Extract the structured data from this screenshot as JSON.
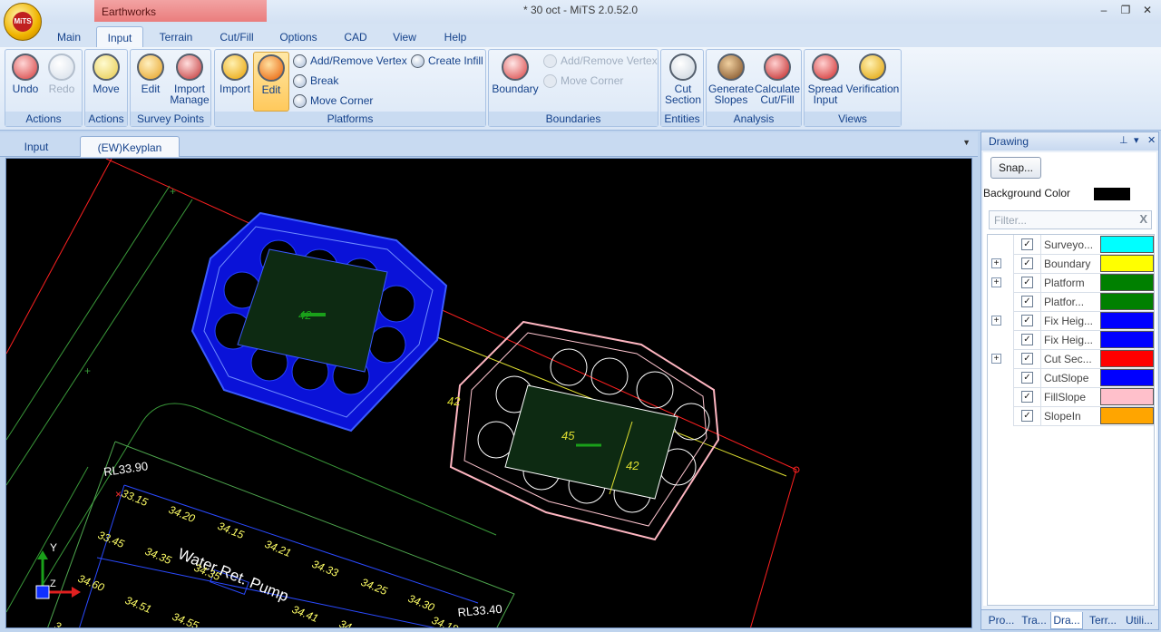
{
  "titlebar": {
    "context_tab": "Earthworks",
    "app_title": "* 30 oct - MiTS 2.0.52.0",
    "logo_text": "MiTS",
    "minimize": "–",
    "maximize": "❐",
    "close": "✕"
  },
  "menu": [
    "Main",
    "Input",
    "Terrain",
    "Cut/Fill",
    "Options",
    "CAD",
    "View",
    "Help"
  ],
  "ribbon": {
    "actions": {
      "label": "Actions",
      "undo": "Undo",
      "redo": "Redo"
    },
    "actions2": {
      "label": "Actions",
      "move": "Move"
    },
    "survey": {
      "label": "Survey Points",
      "edit": "Edit",
      "import1": "Import",
      "import2": "Manage"
    },
    "platforms": {
      "label": "Platforms",
      "import": "Import",
      "edit": "Edit",
      "add_remove_vertex": "Add/Remove Vertex",
      "create_infill": "Create Infill",
      "break": "Break",
      "move_corner": "Move Corner"
    },
    "boundaries": {
      "label": "Boundaries",
      "boundary": "Boundary",
      "add_remove_vertex": "Add/Remove Vertex",
      "move_corner": "Move Corner"
    },
    "entities": {
      "label": "Entities",
      "cut1": "Cut",
      "cut2": "Section"
    },
    "analysis": {
      "label": "Analysis",
      "gen1": "Generate",
      "gen2": "Slopes",
      "calc1": "Calculate",
      "calc2": "Cut/Fill"
    },
    "views": {
      "label": "Views",
      "spread1": "Spread",
      "spread2": "Input",
      "verification": "Verification"
    }
  },
  "doc_tabs": [
    "Input",
    "(EW)Keyplan"
  ],
  "drawing": {
    "labels": {
      "platform1": "42",
      "platform2_a": "45",
      "platform2_b": "42",
      "slope_label": "42",
      "rl1": "RL33.90",
      "rl2": "RL33.40",
      "pump": "Water Ret. Pump",
      "axis_y": "Y",
      "axis_z": "Z"
    },
    "levels": [
      "33.15",
      "34.20",
      "34.15",
      "34.21",
      "34.33",
      "34.25",
      "34.30",
      "33.45",
      "34.35",
      "34.35",
      "34.60",
      "34.51",
      "34.55",
      "34.41",
      "34.18"
    ],
    "levels_row_partial": [
      "34.",
      "3"
    ]
  },
  "panel": {
    "title": "Drawing",
    "pin": "⊥",
    "menu": "▾",
    "close": "✕",
    "snap_button": "Snap...",
    "background_label": "Background Color",
    "background_color": "#000000",
    "filter_placeholder": "Filter...",
    "filter_clear": "X",
    "layers": [
      {
        "name": "Surveyo...",
        "color": "#00ffff",
        "expandable": false,
        "checked": true
      },
      {
        "name": "Boundary",
        "color": "#ffff00",
        "expandable": true,
        "checked": true
      },
      {
        "name": "Platform",
        "color": "#008000",
        "expandable": true,
        "checked": true
      },
      {
        "name": "Platfor...",
        "color": "#008000",
        "expandable": false,
        "checked": true
      },
      {
        "name": "Fix Heig...",
        "color": "#0000ff",
        "expandable": true,
        "checked": true
      },
      {
        "name": "Fix Heig...",
        "color": "#0000ff",
        "expandable": false,
        "checked": true
      },
      {
        "name": "Cut Sec...",
        "color": "#ff0000",
        "expandable": true,
        "checked": true
      },
      {
        "name": "CutSlope",
        "color": "#0000ff",
        "expandable": false,
        "checked": true
      },
      {
        "name": "FillSlope",
        "color": "#ffc0cb",
        "expandable": false,
        "checked": true
      },
      {
        "name": "SlopeIn",
        "color": "#ffa500",
        "expandable": false,
        "checked": true
      }
    ],
    "check_mark": "✓",
    "expand_mark": "+",
    "bottom_tabs": [
      "Pro...",
      "Tra...",
      "Dra...",
      "Terr...",
      "Utili..."
    ]
  }
}
